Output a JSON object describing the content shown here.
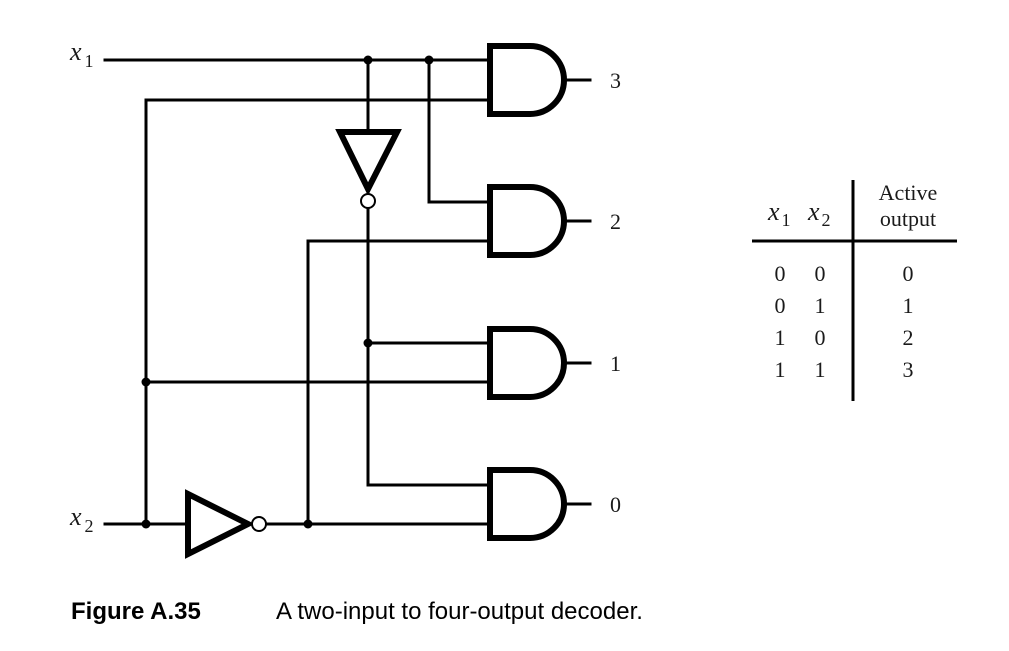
{
  "figure": {
    "label": "Figure A.35",
    "caption": "A two-input to four-output decoder."
  },
  "inputs": [
    {
      "name": "x",
      "subscript": "1"
    },
    {
      "name": "x",
      "subscript": "2"
    }
  ],
  "gates": {
    "and_gates": [
      {
        "output_label": "3",
        "inputs": [
          "x1",
          "x2"
        ]
      },
      {
        "output_label": "2",
        "inputs": [
          "x1",
          "NOT x2"
        ]
      },
      {
        "output_label": "1",
        "inputs": [
          "NOT x1",
          "x2"
        ]
      },
      {
        "output_label": "0",
        "inputs": [
          "NOT x1",
          "NOT x2"
        ]
      }
    ],
    "inverters": [
      {
        "input": "x1",
        "output": "NOT x1",
        "orientation": "down"
      },
      {
        "input": "x2",
        "output": "NOT x2",
        "orientation": "right"
      }
    ]
  },
  "truth_table": {
    "headers": {
      "x1": {
        "name": "x",
        "subscript": "1"
      },
      "x2": {
        "name": "x",
        "subscript": "2"
      },
      "output_line1": "Active",
      "output_line2": "output"
    },
    "rows": [
      {
        "x1": "0",
        "x2": "0",
        "out": "0"
      },
      {
        "x1": "0",
        "x2": "1",
        "out": "1"
      },
      {
        "x1": "1",
        "x2": "0",
        "out": "2"
      },
      {
        "x1": "1",
        "x2": "1",
        "out": "3"
      }
    ]
  }
}
